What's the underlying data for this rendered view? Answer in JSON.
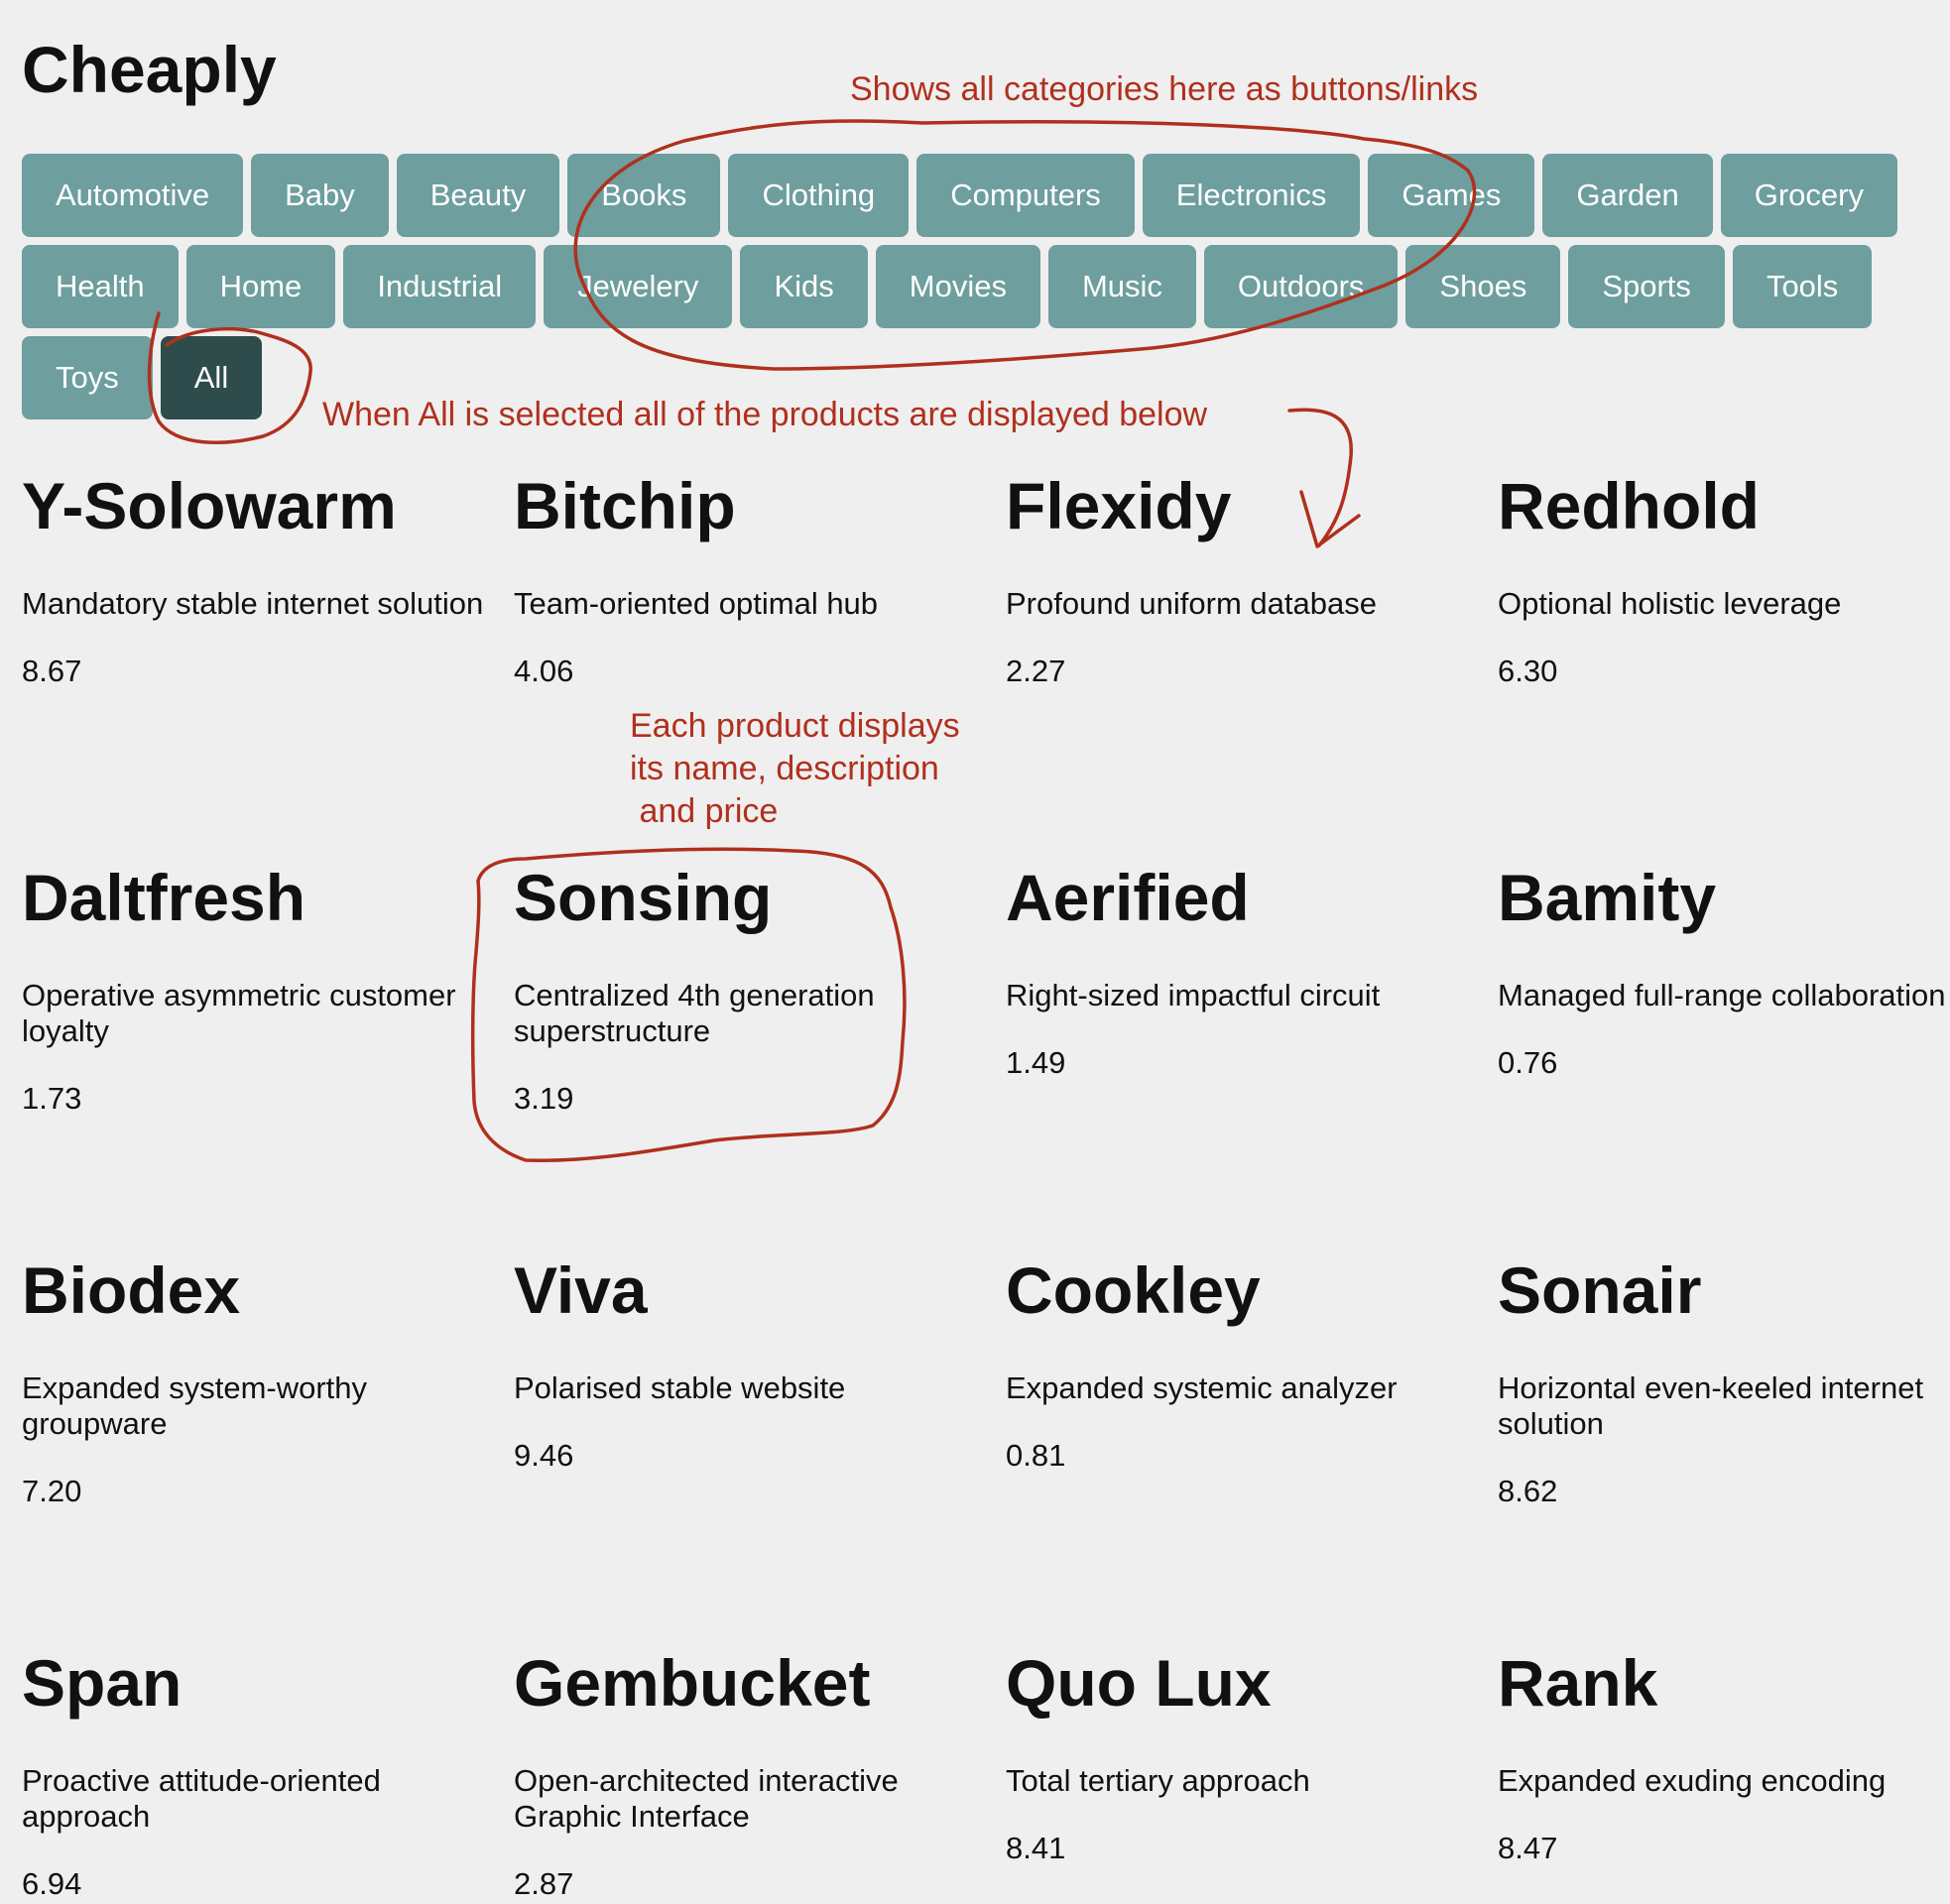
{
  "header": {
    "title": "Cheaply"
  },
  "categories": [
    {
      "label": "Automotive",
      "selected": false
    },
    {
      "label": "Baby",
      "selected": false
    },
    {
      "label": "Beauty",
      "selected": false
    },
    {
      "label": "Books",
      "selected": false
    },
    {
      "label": "Clothing",
      "selected": false
    },
    {
      "label": "Computers",
      "selected": false
    },
    {
      "label": "Electronics",
      "selected": false
    },
    {
      "label": "Games",
      "selected": false
    },
    {
      "label": "Garden",
      "selected": false
    },
    {
      "label": "Grocery",
      "selected": false
    },
    {
      "label": "Health",
      "selected": false
    },
    {
      "label": "Home",
      "selected": false
    },
    {
      "label": "Industrial",
      "selected": false
    },
    {
      "label": "Jewelery",
      "selected": false
    },
    {
      "label": "Kids",
      "selected": false
    },
    {
      "label": "Movies",
      "selected": false
    },
    {
      "label": "Music",
      "selected": false
    },
    {
      "label": "Outdoors",
      "selected": false
    },
    {
      "label": "Shoes",
      "selected": false
    },
    {
      "label": "Sports",
      "selected": false
    },
    {
      "label": "Tools",
      "selected": false
    },
    {
      "label": "Toys",
      "selected": false
    },
    {
      "label": "All",
      "selected": true
    }
  ],
  "products": [
    {
      "name": "Y-Solowarm",
      "description": "Mandatory stable internet solution",
      "price": "8.67"
    },
    {
      "name": "Bitchip",
      "description": "Team-oriented optimal hub",
      "price": "4.06"
    },
    {
      "name": "Flexidy",
      "description": "Profound uniform database",
      "price": "2.27"
    },
    {
      "name": "Redhold",
      "description": "Optional holistic leverage",
      "price": "6.30"
    },
    {
      "name": "Daltfresh",
      "description": "Operative asymmetric customer loyalty",
      "price": "1.73"
    },
    {
      "name": "Sonsing",
      "description": "Centralized 4th generation superstructure",
      "price": "3.19"
    },
    {
      "name": "Aerified",
      "description": "Right-sized impactful circuit",
      "price": "1.49"
    },
    {
      "name": "Bamity",
      "description": "Managed full-range collaboration",
      "price": "0.76"
    },
    {
      "name": "Biodex",
      "description": "Expanded system-worthy groupware",
      "price": "7.20"
    },
    {
      "name": "Viva",
      "description": "Polarised stable website",
      "price": "9.46"
    },
    {
      "name": "Cookley",
      "description": "Expanded systemic analyzer",
      "price": "0.81"
    },
    {
      "name": "Sonair",
      "description": "Horizontal even-keeled internet solution",
      "price": "8.62"
    },
    {
      "name": "Span",
      "description": "Proactive attitude-oriented approach",
      "price": "6.94"
    },
    {
      "name": "Gembucket",
      "description": "Open-architected interactive Graphic Interface",
      "price": "2.87"
    },
    {
      "name": "Quo Lux",
      "description": "Total tertiary approach",
      "price": "8.41"
    },
    {
      "name": "Rank",
      "description": "Expanded exuding encoding",
      "price": "8.47"
    }
  ],
  "annotations": {
    "categories_note": "Shows all categories here as buttons/links",
    "all_note": "When All is selected all of the products are displayed below",
    "product_note": "Each product displays\nits name, description\n and price"
  },
  "colors": {
    "background": "#efefef",
    "category_button": "#6e9e9e",
    "category_button_selected": "#2e4c4c",
    "annotation": "#b0301d"
  }
}
